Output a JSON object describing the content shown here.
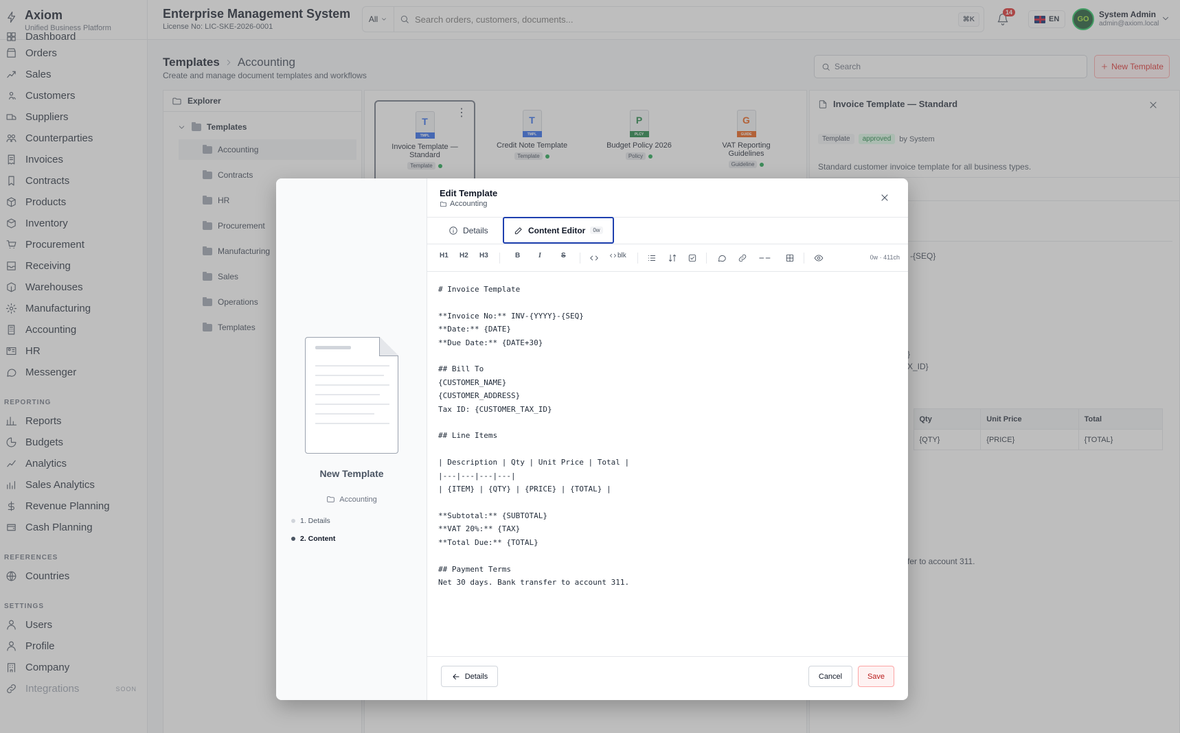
{
  "brand": {
    "name": "Axiom",
    "subtitle": "Unified Business Platform"
  },
  "header": {
    "title": "Enterprise Management System",
    "license": "License No: LIC-SKE-2026-0001",
    "search_scope": "All",
    "search_placeholder": "Search orders, customers, documents...",
    "shortcut": "⌘K",
    "notifications": "14",
    "language": "EN",
    "user_initials": "GO",
    "user_name": "System Admin",
    "user_email": "admin@axiom.local"
  },
  "sidebar": {
    "main": [
      "Dashboard",
      "Orders",
      "Sales",
      "Customers",
      "Suppliers",
      "Counterparties",
      "Invoices",
      "Contracts",
      "Products",
      "Inventory",
      "Procurement",
      "Receiving",
      "Warehouses",
      "Manufacturing",
      "Accounting",
      "HR",
      "Messenger"
    ],
    "reporting_label": "REPORTING",
    "reporting": [
      "Reports",
      "Budgets",
      "Analytics",
      "Sales Analytics",
      "Revenue Planning",
      "Cash Planning"
    ],
    "references_label": "REFERENCES",
    "references": [
      "Countries"
    ],
    "settings_label": "SETTINGS",
    "settings": [
      "Users",
      "Profile",
      "Company",
      "Integrations"
    ],
    "soon_label": "SOON"
  },
  "page": {
    "crumb_root": "Templates",
    "crumb_current": "Accounting",
    "subtitle": "Create and manage document templates and workflows",
    "search_placeholder": "Search",
    "new_button": "New Template"
  },
  "explorer": {
    "title": "Explorer",
    "root": "Templates",
    "folders": [
      "Accounting",
      "Contracts",
      "HR",
      "Procurement",
      "Manufacturing",
      "Sales",
      "Operations",
      "Templates"
    ]
  },
  "cards": [
    {
      "letter": "T",
      "tag": "TMPL",
      "color": "#2563eb",
      "name": "Invoice Template — Standard",
      "type": "Template"
    },
    {
      "letter": "T",
      "tag": "TMPL",
      "color": "#2563eb",
      "name": "Credit Note Template",
      "type": "Template"
    },
    {
      "letter": "P",
      "tag": "PLCY",
      "color": "#15803d",
      "name": "Budget Policy 2026",
      "type": "Policy"
    },
    {
      "letter": "G",
      "tag": "GUIDE",
      "color": "#ea580c",
      "name": "VAT Reporting Guidelines",
      "type": "Guideline"
    }
  ],
  "detail": {
    "title": "Invoice Template — Standard",
    "tag_type": "Template",
    "tag_status": "approved",
    "author": "by System",
    "description": "Standard customer invoice template for all business types.",
    "frag_seq": "-{SEQ}",
    "frag_brace": "}",
    "frag_taxid": "X_ID}",
    "frag_payment": "fer to account 311.",
    "table_headers": [
      "Qty",
      "Unit Price",
      "Total"
    ],
    "table_row": [
      "{QTY}",
      "{PRICE}",
      "{TOTAL}"
    ]
  },
  "modal": {
    "title": "Edit Template",
    "folder": "Accounting",
    "tab_details": "Details",
    "tab_editor": "Content Editor",
    "word_count_badge": "0w",
    "toolbar": {
      "h1": "H1",
      "h2": "H2",
      "h3": "H3",
      "bold": "B",
      "italic": "I",
      "strike": "S",
      "code_block": "blk",
      "stats": "0w · 411ch"
    },
    "content": "# Invoice Template\n\n**Invoice No:** INV-{YYYY}-{SEQ}\n**Date:** {DATE}\n**Due Date:** {DATE+30}\n\n## Bill To\n{CUSTOMER_NAME}\n{CUSTOMER_ADDRESS}\nTax ID: {CUSTOMER_TAX_ID}\n\n## Line Items\n\n| Description | Qty | Unit Price | Total |\n|---|---|---|---|\n| {ITEM} | {QTY} | {PRICE} | {TOTAL} |\n\n**Subtotal:** {SUBTOTAL}\n**VAT 20%:** {TAX}\n**Total Due:** {TOTAL}\n\n## Payment Terms\nNet 30 days. Bank transfer to account 311.",
    "preview_title": "New Template",
    "preview_folder": "Accounting",
    "steps": [
      "1. Details",
      "2. Content"
    ],
    "back_button": "Details",
    "cancel_button": "Cancel",
    "save_button": "Save"
  },
  "colors": {
    "accent": "#dc2626",
    "focus": "#1e40af",
    "status_ok": "#16a34a"
  }
}
